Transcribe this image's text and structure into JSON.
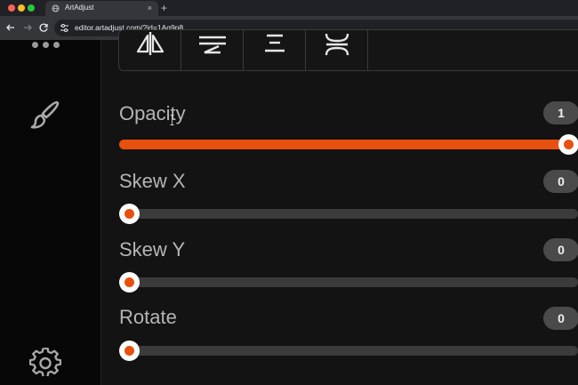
{
  "browser": {
    "tab_title": "ArtAdjust",
    "tab_close": "×",
    "new_tab": "+",
    "url": "editor.artadjust.com/?id=1Aq9p8"
  },
  "sidebar": {
    "top_icon": "more-dots-icon",
    "tool_icon": "brush-icon",
    "bottom_icon": "gear-icon"
  },
  "alignment": {
    "buttons": [
      "align-center-vertical-icon",
      "align-middle-icon",
      "distribute-horizontal-icon",
      "distribute-vertical-icon"
    ]
  },
  "controls": [
    {
      "label": "Opacity",
      "value": "1",
      "fraction": 1.0
    },
    {
      "label": "Skew X",
      "value": "0",
      "fraction": 0.0
    },
    {
      "label": "Skew Y",
      "value": "0",
      "fraction": 0.0
    },
    {
      "label": "Rotate",
      "value": "0",
      "fraction": 0.0
    }
  ],
  "colors": {
    "accent": "#e8500f",
    "track": "#3b3b3b",
    "badge": "#4a4a4a"
  }
}
